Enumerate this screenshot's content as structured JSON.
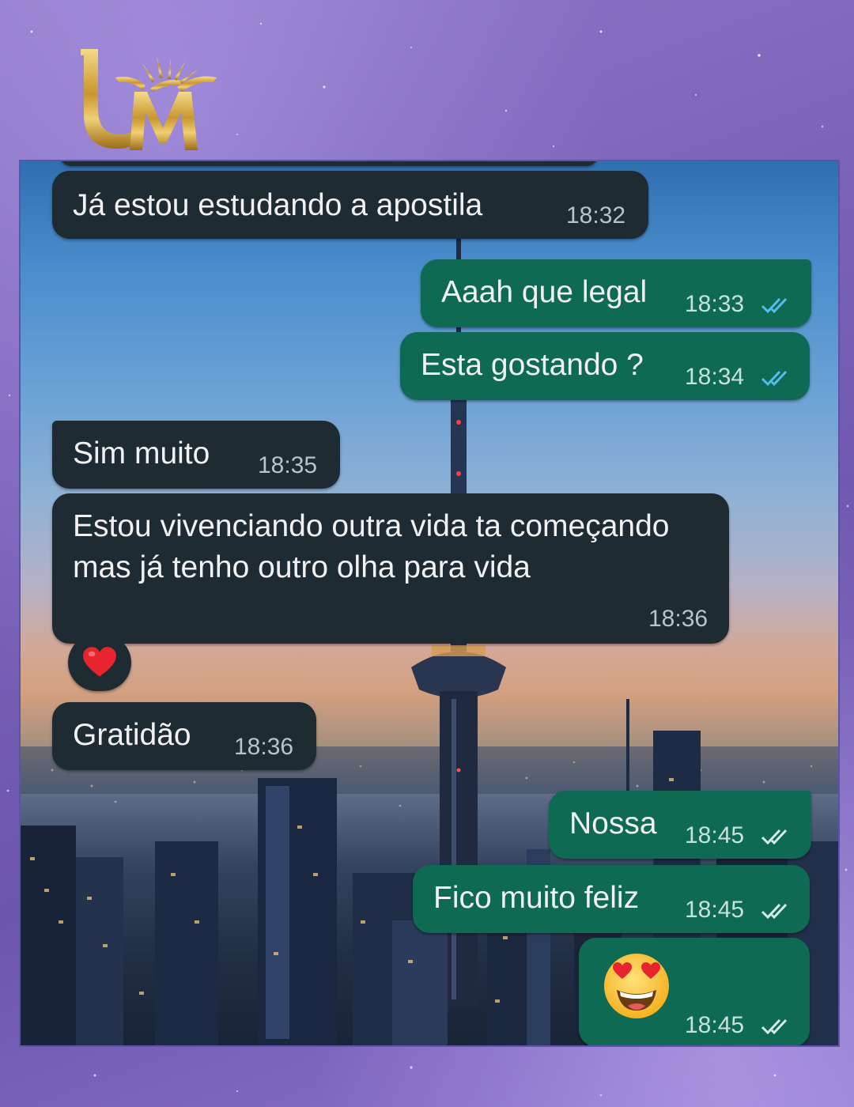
{
  "brand": {
    "logo_text": "UM",
    "gold": "#d4a640"
  },
  "chat": {
    "messages": [
      {
        "from": "contact",
        "text": "Já estou estudando a apostila",
        "time": "18:32"
      },
      {
        "from": "me",
        "text": "Aaah que legal",
        "time": "18:33",
        "status": "read-ticks-icon"
      },
      {
        "from": "me",
        "text": "Esta gostando ?",
        "time": "18:34",
        "status": "read-ticks-icon"
      },
      {
        "from": "contact",
        "text": "Sim muito",
        "time": "18:35"
      },
      {
        "from": "contact",
        "text": "Estou vivenciando outra vida ta começando mas já tenho outro olha para vida",
        "time": "18:36",
        "reaction": "heart-icon"
      },
      {
        "from": "contact",
        "text": "Gratidão",
        "time": "18:36"
      },
      {
        "from": "me",
        "text": "Nossa",
        "time": "18:45",
        "status": "read-ticks-icon"
      },
      {
        "from": "me",
        "text": "Fico muito feliz",
        "time": "18:45",
        "status": "read-ticks-icon"
      },
      {
        "from": "me",
        "text": "",
        "emoji": "heart-eyes-emoji-icon",
        "time": "18:45",
        "status": "read-ticks-icon"
      }
    ]
  },
  "colors": {
    "incoming_bubble": "#1f2b32",
    "outgoing_bubble": "#0e6a52",
    "read_ticks": "#53bdeb",
    "background": "#7a62b8"
  }
}
